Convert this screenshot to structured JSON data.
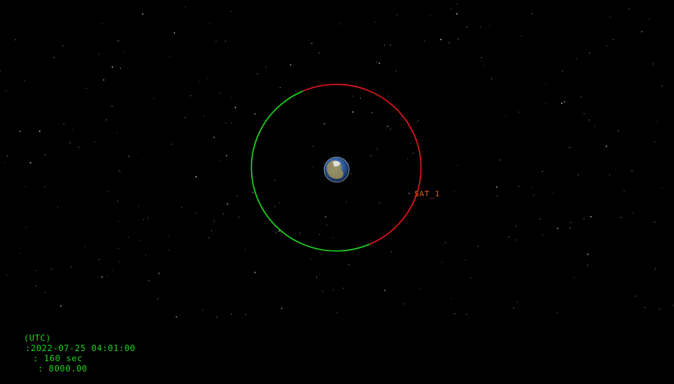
{
  "colors": {
    "background": "#000000",
    "orbit_lit": "#e0141e",
    "orbit_shadow": "#1ed21e",
    "sat_label": "#e05a1a",
    "status_text": "#1ed21e",
    "stars": "#cfcfcf"
  },
  "satellite": {
    "name": "SAT_1"
  },
  "status": {
    "utc_label": "(UTC)",
    "datetime": ":2022-07-25 04:01:00",
    "step": ": 160 sec",
    "scale": ": 8000.00"
  },
  "icons": {
    "earth": "earth-globe-icon"
  }
}
